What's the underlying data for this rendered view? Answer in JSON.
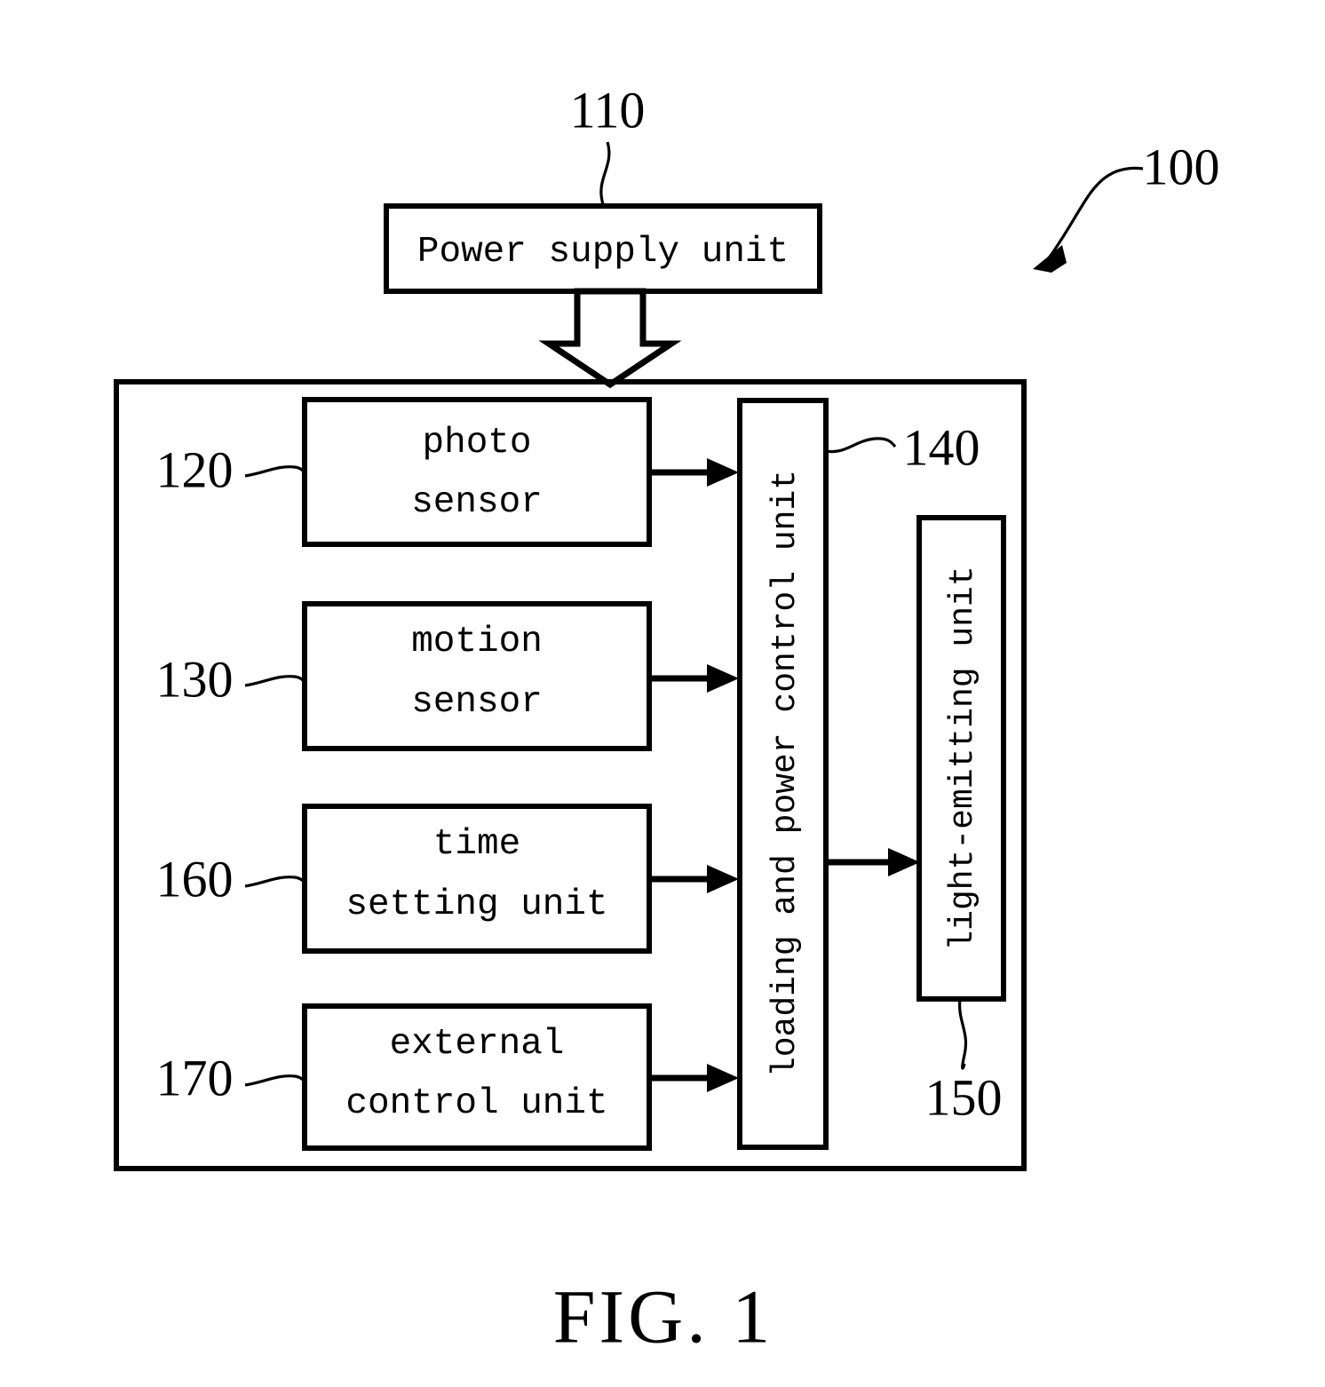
{
  "figure": {
    "caption": "FIG. 1",
    "system_ref": "100"
  },
  "blocks": [
    {
      "id": "power-supply-unit",
      "label": "Power supply unit",
      "ref": "110",
      "orientation": "horizontal"
    },
    {
      "id": "photo-sensor",
      "label_line1": "photo",
      "label_line2": "sensor",
      "ref": "120",
      "orientation": "horizontal"
    },
    {
      "id": "motion-sensor",
      "label_line1": "motion",
      "label_line2": "sensor",
      "ref": "130",
      "orientation": "horizontal"
    },
    {
      "id": "time-setting-unit",
      "label_line1": "time",
      "label_line2": "setting unit",
      "ref": "160",
      "orientation": "horizontal"
    },
    {
      "id": "external-control-unit",
      "label_line1": "external",
      "label_line2": "control unit",
      "ref": "170",
      "orientation": "horizontal"
    },
    {
      "id": "loading-and-power-control-unit",
      "label": "loading and power control unit",
      "ref": "140",
      "orientation": "vertical"
    },
    {
      "id": "light-emitting-unit",
      "label": "light-emitting unit",
      "ref": "150",
      "orientation": "vertical"
    }
  ],
  "refs": {
    "r100": "100",
    "r110": "110",
    "r120": "120",
    "r130": "130",
    "r140": "140",
    "r150": "150",
    "r160": "160",
    "r170": "170"
  },
  "texts": {
    "power_supply_unit": "Power supply unit",
    "photo": "photo",
    "sensor_1": "sensor",
    "motion": "motion",
    "sensor_2": "sensor",
    "time": "time",
    "setting_unit": "setting unit",
    "external": "external",
    "control_unit": "control unit",
    "loading_and_power_control_unit": "loading and power control unit",
    "light_emitting_unit": "light-emitting unit",
    "fig_caption": "FIG. 1"
  },
  "colors": {
    "background": "#ffffff",
    "stroke": "#000000",
    "fill": "#ffffff"
  },
  "connections": [
    {
      "from": "photo-sensor",
      "to": "loading-and-power-control-unit",
      "style": "solid-arrow"
    },
    {
      "from": "motion-sensor",
      "to": "loading-and-power-control-unit",
      "style": "solid-arrow"
    },
    {
      "from": "time-setting-unit",
      "to": "loading-and-power-control-unit",
      "style": "solid-arrow"
    },
    {
      "from": "external-control-unit",
      "to": "loading-and-power-control-unit",
      "style": "solid-arrow"
    },
    {
      "from": "loading-and-power-control-unit",
      "to": "light-emitting-unit",
      "style": "solid-arrow"
    },
    {
      "from": "power-supply-unit",
      "to": "system-container",
      "style": "hollow-block-arrow"
    }
  ]
}
